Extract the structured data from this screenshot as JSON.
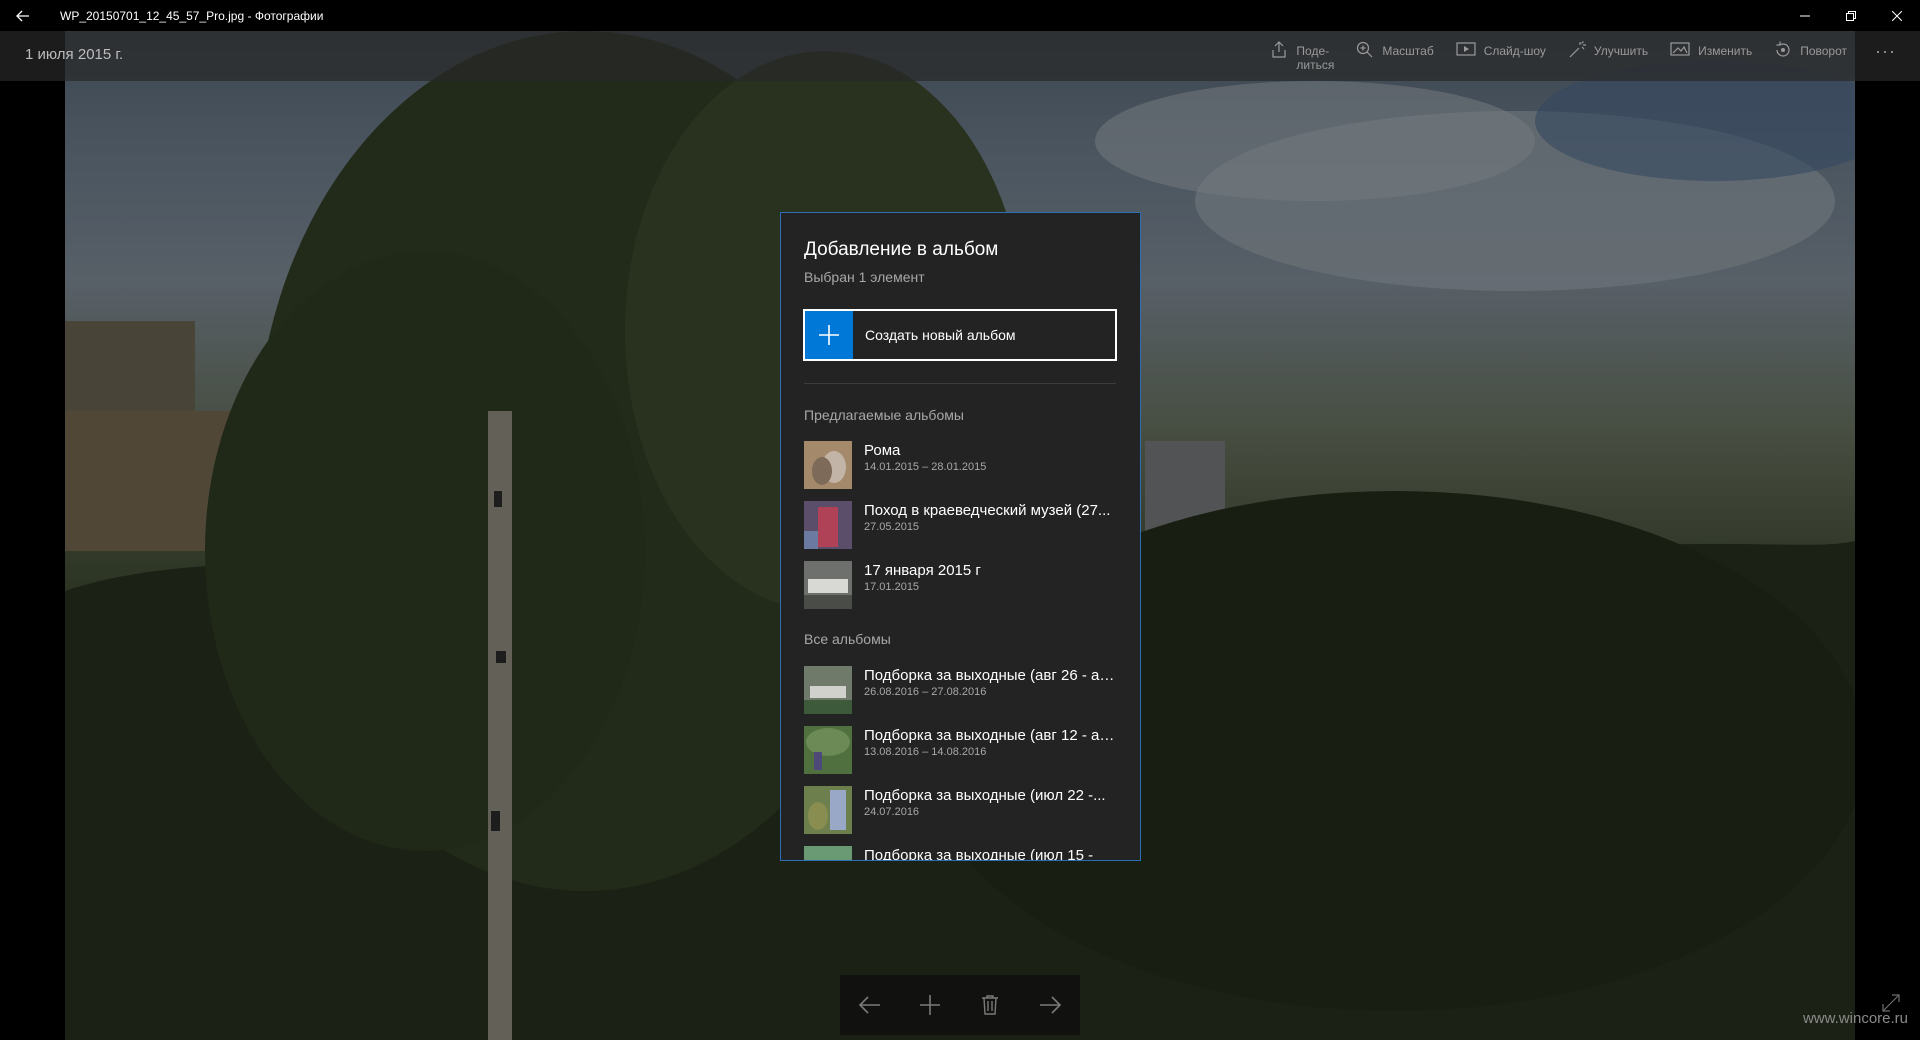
{
  "window": {
    "title": "WP_20150701_12_45_57_Pro.jpg - Фотографии"
  },
  "appbar": {
    "date": "1 июля 2015 г.",
    "share": {
      "line1": "Поде-",
      "line2": "литься",
      "icon": "share-icon"
    },
    "zoom": {
      "label": "Масштаб",
      "icon": "zoom-icon"
    },
    "slideshow": {
      "label": "Слайд-шоу",
      "icon": "slideshow-icon"
    },
    "enhance": {
      "label": "Улучшить",
      "icon": "magic-wand-icon"
    },
    "edit": {
      "label": "Изменить",
      "icon": "edit-image-icon"
    },
    "rotate": {
      "label": "Поворот",
      "icon": "rotate-icon"
    },
    "more": {
      "label": "···",
      "icon": "more-icon"
    }
  },
  "dialog": {
    "title": "Добавление в альбом",
    "subtitle": "Выбран 1 элемент",
    "create_label": "Создать новый альбом",
    "suggested_title": "Предлагаемые альбомы",
    "suggested": [
      {
        "name": "Рома",
        "dates": "14.01.2015 – 28.01.2015"
      },
      {
        "name": "Поход в краеведческий музей (27...",
        "dates": "27.05.2015"
      },
      {
        "name": "17 января 2015 г",
        "dates": "17.01.2015"
      }
    ],
    "all_title": "Все альбомы",
    "all": [
      {
        "name": "Подборка за выходные (авг 26 - ав...",
        "dates": "26.08.2016 – 27.08.2016"
      },
      {
        "name": "Подборка за выходные (авг 12 - ав...",
        "dates": "13.08.2016 – 14.08.2016"
      },
      {
        "name": "Подборка за выходные (июл 22 -...",
        "dates": "24.07.2016"
      },
      {
        "name": "Подборка за выходные (июл 15 -",
        "dates": ""
      }
    ]
  },
  "watermark": "www.wincore.ru",
  "colors": {
    "accent": "#0078d7",
    "dialog_bg": "#232323",
    "dialog_border": "#2d6fb4"
  }
}
